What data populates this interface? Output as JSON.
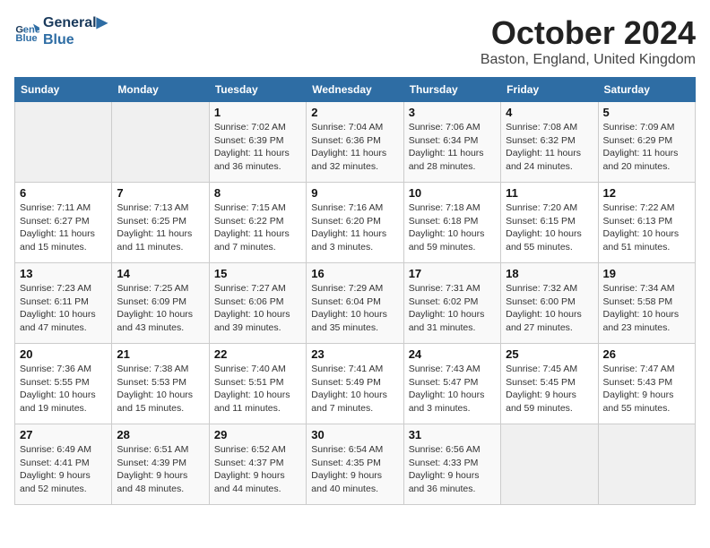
{
  "logo": {
    "line1": "General",
    "line2": "Blue"
  },
  "title": "October 2024",
  "location": "Baston, England, United Kingdom",
  "weekdays": [
    "Sunday",
    "Monday",
    "Tuesday",
    "Wednesday",
    "Thursday",
    "Friday",
    "Saturday"
  ],
  "weeks": [
    [
      {
        "day": "",
        "info": ""
      },
      {
        "day": "",
        "info": ""
      },
      {
        "day": "1",
        "info": "Sunrise: 7:02 AM\nSunset: 6:39 PM\nDaylight: 11 hours and 36 minutes."
      },
      {
        "day": "2",
        "info": "Sunrise: 7:04 AM\nSunset: 6:36 PM\nDaylight: 11 hours and 32 minutes."
      },
      {
        "day": "3",
        "info": "Sunrise: 7:06 AM\nSunset: 6:34 PM\nDaylight: 11 hours and 28 minutes."
      },
      {
        "day": "4",
        "info": "Sunrise: 7:08 AM\nSunset: 6:32 PM\nDaylight: 11 hours and 24 minutes."
      },
      {
        "day": "5",
        "info": "Sunrise: 7:09 AM\nSunset: 6:29 PM\nDaylight: 11 hours and 20 minutes."
      }
    ],
    [
      {
        "day": "6",
        "info": "Sunrise: 7:11 AM\nSunset: 6:27 PM\nDaylight: 11 hours and 15 minutes."
      },
      {
        "day": "7",
        "info": "Sunrise: 7:13 AM\nSunset: 6:25 PM\nDaylight: 11 hours and 11 minutes."
      },
      {
        "day": "8",
        "info": "Sunrise: 7:15 AM\nSunset: 6:22 PM\nDaylight: 11 hours and 7 minutes."
      },
      {
        "day": "9",
        "info": "Sunrise: 7:16 AM\nSunset: 6:20 PM\nDaylight: 11 hours and 3 minutes."
      },
      {
        "day": "10",
        "info": "Sunrise: 7:18 AM\nSunset: 6:18 PM\nDaylight: 10 hours and 59 minutes."
      },
      {
        "day": "11",
        "info": "Sunrise: 7:20 AM\nSunset: 6:15 PM\nDaylight: 10 hours and 55 minutes."
      },
      {
        "day": "12",
        "info": "Sunrise: 7:22 AM\nSunset: 6:13 PM\nDaylight: 10 hours and 51 minutes."
      }
    ],
    [
      {
        "day": "13",
        "info": "Sunrise: 7:23 AM\nSunset: 6:11 PM\nDaylight: 10 hours and 47 minutes."
      },
      {
        "day": "14",
        "info": "Sunrise: 7:25 AM\nSunset: 6:09 PM\nDaylight: 10 hours and 43 minutes."
      },
      {
        "day": "15",
        "info": "Sunrise: 7:27 AM\nSunset: 6:06 PM\nDaylight: 10 hours and 39 minutes."
      },
      {
        "day": "16",
        "info": "Sunrise: 7:29 AM\nSunset: 6:04 PM\nDaylight: 10 hours and 35 minutes."
      },
      {
        "day": "17",
        "info": "Sunrise: 7:31 AM\nSunset: 6:02 PM\nDaylight: 10 hours and 31 minutes."
      },
      {
        "day": "18",
        "info": "Sunrise: 7:32 AM\nSunset: 6:00 PM\nDaylight: 10 hours and 27 minutes."
      },
      {
        "day": "19",
        "info": "Sunrise: 7:34 AM\nSunset: 5:58 PM\nDaylight: 10 hours and 23 minutes."
      }
    ],
    [
      {
        "day": "20",
        "info": "Sunrise: 7:36 AM\nSunset: 5:55 PM\nDaylight: 10 hours and 19 minutes."
      },
      {
        "day": "21",
        "info": "Sunrise: 7:38 AM\nSunset: 5:53 PM\nDaylight: 10 hours and 15 minutes."
      },
      {
        "day": "22",
        "info": "Sunrise: 7:40 AM\nSunset: 5:51 PM\nDaylight: 10 hours and 11 minutes."
      },
      {
        "day": "23",
        "info": "Sunrise: 7:41 AM\nSunset: 5:49 PM\nDaylight: 10 hours and 7 minutes."
      },
      {
        "day": "24",
        "info": "Sunrise: 7:43 AM\nSunset: 5:47 PM\nDaylight: 10 hours and 3 minutes."
      },
      {
        "day": "25",
        "info": "Sunrise: 7:45 AM\nSunset: 5:45 PM\nDaylight: 9 hours and 59 minutes."
      },
      {
        "day": "26",
        "info": "Sunrise: 7:47 AM\nSunset: 5:43 PM\nDaylight: 9 hours and 55 minutes."
      }
    ],
    [
      {
        "day": "27",
        "info": "Sunrise: 6:49 AM\nSunset: 4:41 PM\nDaylight: 9 hours and 52 minutes."
      },
      {
        "day": "28",
        "info": "Sunrise: 6:51 AM\nSunset: 4:39 PM\nDaylight: 9 hours and 48 minutes."
      },
      {
        "day": "29",
        "info": "Sunrise: 6:52 AM\nSunset: 4:37 PM\nDaylight: 9 hours and 44 minutes."
      },
      {
        "day": "30",
        "info": "Sunrise: 6:54 AM\nSunset: 4:35 PM\nDaylight: 9 hours and 40 minutes."
      },
      {
        "day": "31",
        "info": "Sunrise: 6:56 AM\nSunset: 4:33 PM\nDaylight: 9 hours and 36 minutes."
      },
      {
        "day": "",
        "info": ""
      },
      {
        "day": "",
        "info": ""
      }
    ]
  ]
}
